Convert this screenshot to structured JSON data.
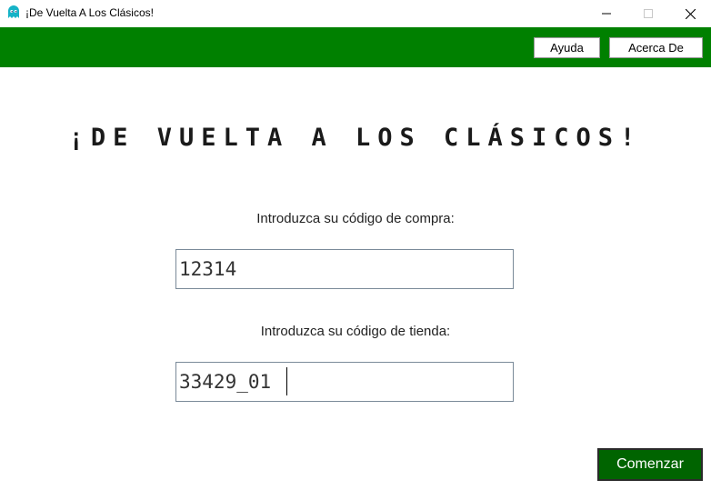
{
  "window": {
    "title": "¡De Vuelta A Los Clásicos!",
    "icon": "ghost-icon",
    "controls": {
      "minimize": "minimize-icon",
      "maximize": "maximize-icon",
      "close": "close-icon"
    }
  },
  "toolbar": {
    "background": "#008000",
    "help_label": "Ayuda",
    "about_label": "Acerca De"
  },
  "main": {
    "heading": "¡DE VUELTA A LOS CLÁSICOS!",
    "purchase_label": "Introduzca su código de compra:",
    "purchase_code": "12314",
    "store_label": "Introduzca su código de tienda:",
    "store_code": "33429_01",
    "start_label": "Comenzar",
    "start_color": "#006400"
  }
}
